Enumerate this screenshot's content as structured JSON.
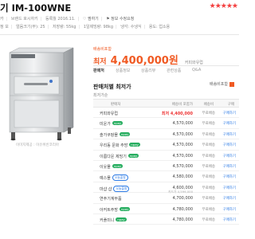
{
  "product": {
    "title": "기 IM-100WNE",
    "stars": "★★★★★",
    "meta1": [
      "카",
      "브랜드 호시자키",
      "등록월 2016.11.",
      "찜하기",
      "정보 수정요청"
    ],
    "meta2": [
      "정 보",
      "얼음크기(부): 25",
      "저장량: 55kg",
      "1일제빙량: 98kg",
      "냉각: 수냉식",
      "용도: 업소용"
    ],
    "photo_caption": "이미지제공 : 이유위빈코리아"
  },
  "price": {
    "best_label": "배송비포함",
    "label": "최저",
    "value": "4,400,000원",
    "shop": "커피와유럽"
  },
  "tabs": [
    "판매처",
    "상품정보",
    "상품리뷰",
    "관련상품",
    "Q&A"
  ],
  "seller_section": {
    "title": "판매처별 최저가",
    "sort": "최저가순",
    "checkbox_label": "배송비포함"
  },
  "table": {
    "headers": [
      "판매처",
      "배송비 포함가",
      "배송비",
      "구매"
    ],
    "rows": [
      {
        "shop": "커피와유럽",
        "badge": "",
        "price": "최저 4,400,000",
        "sub": "",
        "ship": "무료배송",
        "go": "구매하기",
        "best": true
      },
      {
        "shop": "미운가",
        "badge": "npay",
        "price": "4,570,000",
        "sub": "",
        "ship": "무료배송",
        "go": "구매하기",
        "best": false
      },
      {
        "shop": "솔가쿠팡몰",
        "badge": "npay",
        "price": "4,570,000",
        "sub": "",
        "ship": "무료배송",
        "go": "구매하기",
        "best": false
      },
      {
        "shop": "우리동 문화 주방",
        "badge": "npay",
        "price": "4,570,000",
        "sub": "",
        "ship": "무료배송",
        "go": "구매하기",
        "best": false
      },
      {
        "shop": "이름다운 제빙기",
        "badge": "npay",
        "price": "4,570,000",
        "sub": "",
        "ship": "무료배송",
        "go": "구매하기",
        "best": false
      },
      {
        "shop": "이웃몰",
        "badge": "npay",
        "price": "4,570,000",
        "sub": "",
        "ship": "무료배송",
        "go": "구매하기",
        "best": false
      },
      {
        "shop": "예스몰",
        "badge": "오늘출발",
        "price": "4,580,000",
        "sub": "",
        "ship": "무료배송",
        "go": "구매하기",
        "best": false
      },
      {
        "shop": "마샵 샵",
        "badge": "오늘출발",
        "price": "4,600,000",
        "sub": "카드가 4,599,000",
        "ship": "무료배송",
        "go": "구매하기",
        "best": false
      },
      {
        "shop": "연주기계부품",
        "badge": "",
        "price": "4,700,000",
        "sub": "",
        "ship": "무료배송",
        "go": "구매하기",
        "best": false
      },
      {
        "shop": "아커트주방",
        "badge": "npay",
        "price": "4,780,000",
        "sub": "",
        "ship": "무료배송",
        "go": "구매하기",
        "best": false
      },
      {
        "shop": "커플미니",
        "badge": "npay",
        "price": "4,780,000",
        "sub": "",
        "ship": "무료배송",
        "go": "구매하기",
        "best": false
      }
    ]
  },
  "colors": {
    "accent": "#f05a23",
    "npay": "#27ae60",
    "link": "#2d7be5"
  }
}
